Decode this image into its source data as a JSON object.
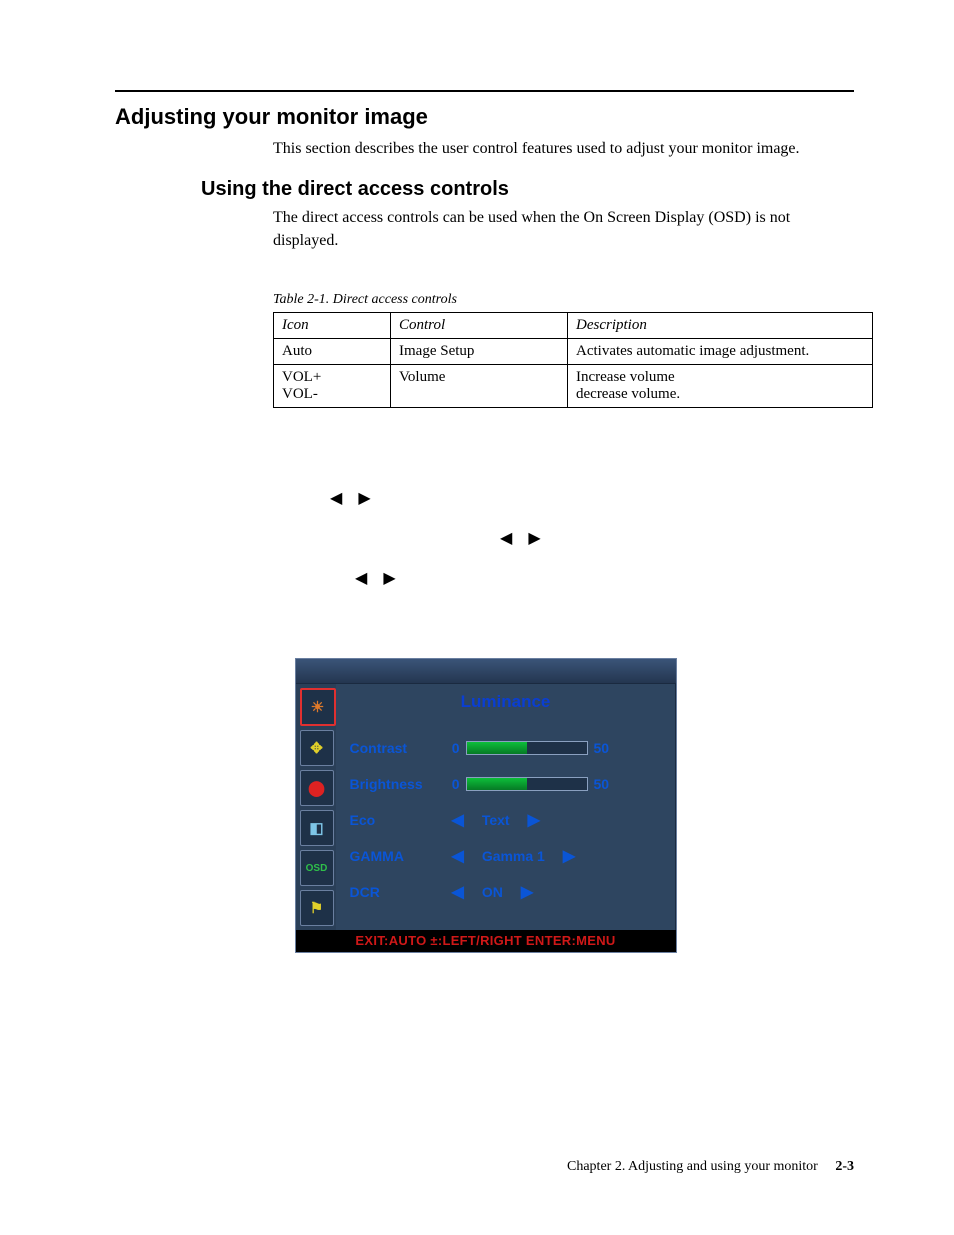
{
  "heading1": "Adjusting your monitor image",
  "intro": "This section describes the user control features used to adjust your monitor image.",
  "heading2": "Using the direct access controls",
  "subintro": "The direct access controls can be used when the On Screen Display (OSD) is not displayed.",
  "table_caption": "Table 2-1. Direct access controls",
  "table": {
    "headers": [
      "Icon",
      "Control",
      "Description"
    ],
    "rows": [
      {
        "icon": "Auto",
        "control": "Image Setup",
        "desc": "Activates automatic image adjustment."
      },
      {
        "icon": "VOL+\nVOL-",
        "control": "Volume",
        "desc": "Increase volume\ndecrease volume."
      }
    ]
  },
  "arrow_glyphs": {
    "left": "◀",
    "right": "▶"
  },
  "osd": {
    "title": "Luminance",
    "side_icons": [
      {
        "name": "luminance-icon",
        "glyph": "☀",
        "color": "#e07a2a",
        "selected": true
      },
      {
        "name": "image-setup-icon",
        "glyph": "✥",
        "color": "#e0cf2a",
        "selected": false
      },
      {
        "name": "color-temp-icon",
        "glyph": "⬤",
        "color": "#d22",
        "selected": false
      },
      {
        "name": "picture-boost-icon",
        "glyph": "◧",
        "color": "#7ec6e8",
        "selected": false
      },
      {
        "name": "osd-setup-icon",
        "glyph": "OSD",
        "color": "#2fbf4a",
        "selected": false
      },
      {
        "name": "extra-icon",
        "glyph": "⚑",
        "color": "#e0cf2a",
        "selected": false
      }
    ],
    "sliders": [
      {
        "label": "Contrast",
        "min": "0",
        "value": "50",
        "percent": 50
      },
      {
        "label": "Brightness",
        "min": "0",
        "value": "50",
        "percent": 50
      }
    ],
    "selects": [
      {
        "label": "Eco",
        "value": "Text"
      },
      {
        "label": "GAMMA",
        "value": "Gamma 1"
      },
      {
        "label": "DCR",
        "value": "ON"
      }
    ],
    "status": "EXIT:AUTO  ±:LEFT/RIGHT  ENTER:MENU"
  },
  "footer": {
    "chapter": "Chapter 2. Adjusting and using your monitor",
    "page": "2-3"
  }
}
